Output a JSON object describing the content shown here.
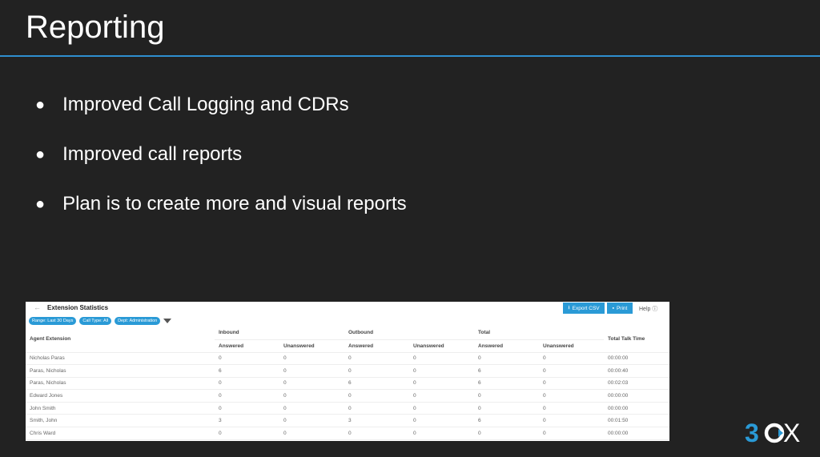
{
  "slide": {
    "title": "Reporting",
    "bullets": [
      "Improved Call Logging and CDRs",
      "Improved call reports",
      "Plan is to create more and visual reports"
    ],
    "logo": "3CX"
  },
  "report": {
    "title": "Extension Statistics",
    "export_label": "Export CSV",
    "print_label": "Print",
    "help_label": "Help",
    "filters": [
      "Range: Last 30 Days",
      "Call Type: All",
      "Dept: Administration"
    ],
    "headers": {
      "agent": "Agent Extension",
      "inbound": "Inbound",
      "outbound": "Outbound",
      "total": "Total",
      "talk": "Total Talk Time",
      "answered": "Answered",
      "unanswered": "Unanswered"
    },
    "rows": [
      [
        "Nicholas Paras",
        "0",
        "0",
        "0",
        "0",
        "0",
        "0",
        "00:00:00"
      ],
      [
        "Paras, Nicholas",
        "6",
        "0",
        "0",
        "0",
        "6",
        "0",
        "00:00:40"
      ],
      [
        "Paras, Nicholas",
        "0",
        "0",
        "6",
        "0",
        "6",
        "0",
        "00:02:03"
      ],
      [
        "Edward Jones",
        "0",
        "0",
        "0",
        "0",
        "0",
        "0",
        "00:00:00"
      ],
      [
        "John Smith",
        "0",
        "0",
        "0",
        "0",
        "0",
        "0",
        "00:00:00"
      ],
      [
        "Smith, John",
        "3",
        "0",
        "3",
        "0",
        "6",
        "0",
        "00:01:50"
      ],
      [
        "Chris Ward",
        "0",
        "0",
        "0",
        "0",
        "0",
        "0",
        "00:00:00"
      ]
    ]
  }
}
